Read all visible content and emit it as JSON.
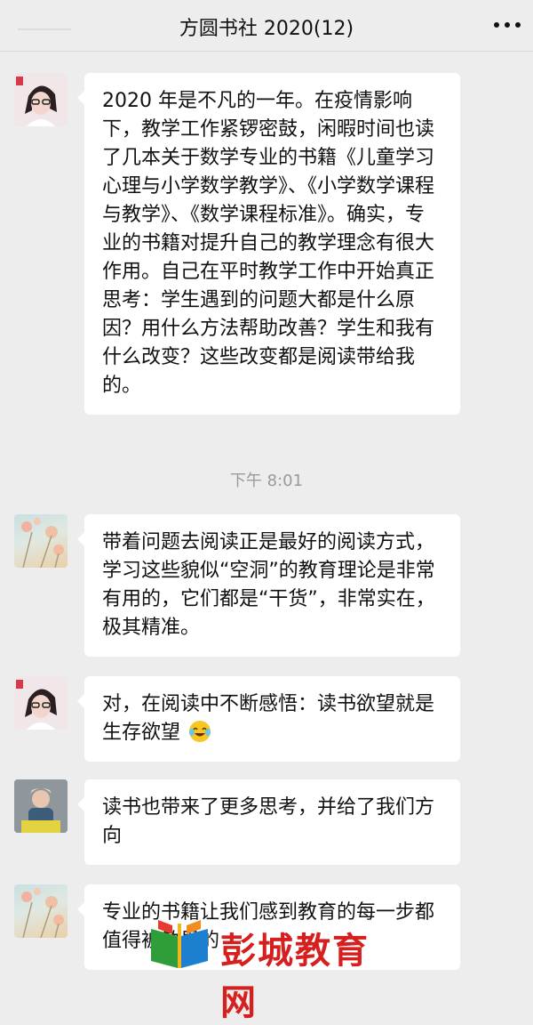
{
  "header": {
    "title": "方圆书社 2020(12)"
  },
  "messages": [
    {
      "avatar": "teacher-avatar",
      "text": "2020 年是不凡的一年。在疫情影响下，教学工作紧锣密鼓，闲暇时间也读了几本关于数学专业的书籍《儿童学习心理与小学数学教学》、《小学数学课程与教学》、《数学课程标准》。确实，专业的书籍对提升自己的教学理念有很大作用。自己在平时教学工作中开始真正思考：学生遇到的问题大都是什么原因？用什么方法帮助改善？学生和我有什么改变？这些改变都是阅读带给我的。"
    },
    {
      "avatar": "flower-avatar",
      "text": "带着问题去阅读正是最好的阅读方式，学习这些貌似“空洞”的教育理论是非常有用的，它们都是“干货”，非常实在，极其精准。"
    },
    {
      "avatar": "teacher-avatar",
      "text": "对，在阅读中不断感悟：读书欲望就是生存欲望"
    },
    {
      "avatar": "child-avatar",
      "text": "读书也带来了更多思考，并给了我们方向"
    },
    {
      "avatar": "flower-avatar",
      "text": "专业的书籍让我们感到教育的每一步都值得被敬畏的"
    }
  ],
  "timestamp": "下午 8:01",
  "watermark": {
    "text": "彭城教育网",
    "url": "www.pcjyedu.cn"
  }
}
